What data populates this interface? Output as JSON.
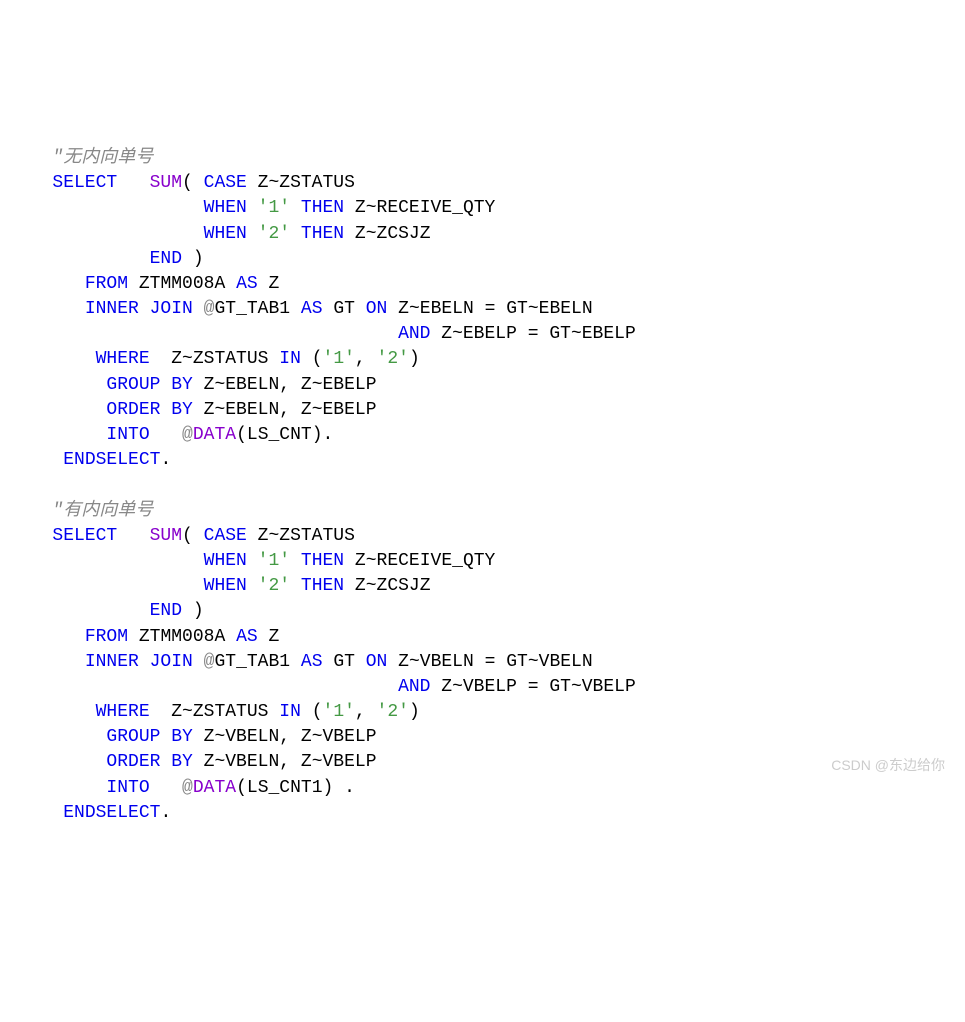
{
  "block1": {
    "comment": "\"无内向单号",
    "l1_select": "SELECT",
    "l1_sum": "SUM",
    "l1_case": "CASE",
    "l1_field": "Z~ZSTATUS",
    "l2_when": "WHEN",
    "l2_val": "'1'",
    "l2_then": "THEN",
    "l2_field": "Z~RECEIVE_QTY",
    "l3_when": "WHEN",
    "l3_val": "'2'",
    "l3_then": "THEN",
    "l3_field": "Z~ZCSJZ",
    "l4_end": "END",
    "l5_from": "FROM",
    "l5_table": "ZTMM008A",
    "l5_as": "AS",
    "l5_alias": "Z",
    "l6_inner": "INNER JOIN",
    "l6_at": "@",
    "l6_tab": "GT_TAB1",
    "l6_as": "AS",
    "l6_alias": "GT",
    "l6_on": "ON",
    "l6_left": "Z~EBELN",
    "l6_eq": "=",
    "l6_right": "GT~EBELN",
    "l7_and": "AND",
    "l7_left": "Z~EBELP",
    "l7_eq": "=",
    "l7_right": "GT~EBELP",
    "l8_where": "WHERE",
    "l8_field": "Z~ZSTATUS",
    "l8_in": "IN",
    "l8_v1": "'1'",
    "l8_comma": ",",
    "l8_v2": "'2'",
    "l9_group": "GROUP BY",
    "l9_f1": "Z~EBELN",
    "l9_f2": "Z~EBELP",
    "l10_order": "ORDER BY",
    "l10_f1": "Z~EBELN",
    "l10_f2": "Z~EBELP",
    "l11_into": "INTO",
    "l11_at": "@",
    "l11_data": "DATA",
    "l11_var": "LS_CNT",
    "l12_end": "ENDSELECT"
  },
  "block2": {
    "comment": "\"有内向单号",
    "l1_select": "SELECT",
    "l1_sum": "SUM",
    "l1_case": "CASE",
    "l1_field": "Z~ZSTATUS",
    "l2_when": "WHEN",
    "l2_val": "'1'",
    "l2_then": "THEN",
    "l2_field": "Z~RECEIVE_QTY",
    "l3_when": "WHEN",
    "l3_val": "'2'",
    "l3_then": "THEN",
    "l3_field": "Z~ZCSJZ",
    "l4_end": "END",
    "l5_from": "FROM",
    "l5_table": "ZTMM008A",
    "l5_as": "AS",
    "l5_alias": "Z",
    "l6_inner": "INNER JOIN",
    "l6_at": "@",
    "l6_tab": "GT_TAB1",
    "l6_as": "AS",
    "l6_alias": "GT",
    "l6_on": "ON",
    "l6_left": "Z~VBELN",
    "l6_eq": "=",
    "l6_right": "GT~VBELN",
    "l7_and": "AND",
    "l7_left": "Z~VBELP",
    "l7_eq": "=",
    "l7_right": "GT~VBELP",
    "l8_where": "WHERE",
    "l8_field": "Z~ZSTATUS",
    "l8_in": "IN",
    "l8_v1": "'1'",
    "l8_comma": ",",
    "l8_v2": "'2'",
    "l9_group": "GROUP BY",
    "l9_f1": "Z~VBELN",
    "l9_f2": "Z~VBELP",
    "l10_order": "ORDER BY",
    "l10_f1": "Z~VBELN",
    "l10_f2": "Z~VBELP",
    "l11_into": "INTO",
    "l11_at": "@",
    "l11_data": "DATA",
    "l11_var": "LS_CNT1",
    "l12_end": "ENDSELECT"
  },
  "watermark": "CSDN @东边给你"
}
